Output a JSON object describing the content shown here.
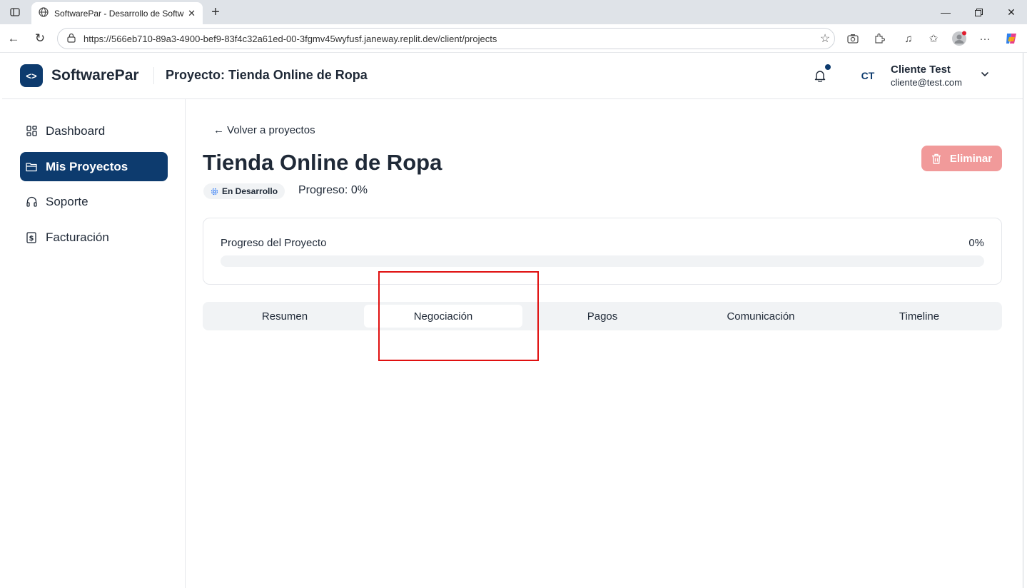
{
  "browser": {
    "tab_title": "SoftwarePar - Desarrollo de Softw",
    "url": "https://566eb710-89a3-4900-bef9-83f4c32a61ed-00-3fgmv45wyfusf.janeway.replit.dev/client/projects"
  },
  "header": {
    "logo_glyph": "<>",
    "brand": "SoftwarePar",
    "project_title": "Proyecto: Tienda Online de Ropa",
    "avatar_initials": "CT",
    "user_name": "Cliente Test",
    "user_email": "cliente@test.com"
  },
  "sidebar": {
    "items": [
      {
        "label": "Dashboard",
        "icon": "grid-icon"
      },
      {
        "label": "Mis Proyectos",
        "icon": "folder-icon",
        "active": true
      },
      {
        "label": "Soporte",
        "icon": "headset-icon"
      },
      {
        "label": "Facturación",
        "icon": "dollar-receipt-icon"
      }
    ]
  },
  "main": {
    "back_link": "← Volver a proyectos",
    "title": "Tienda Online de Ropa",
    "delete_label": "Eliminar",
    "status": "En Desarrollo",
    "progress_inline": "Progreso: 0%",
    "progress_card": {
      "label": "Progreso del Proyecto",
      "value_text": "0%",
      "value": 0
    },
    "tabs": [
      {
        "label": "Resumen"
      },
      {
        "label": "Negociación",
        "active": true
      },
      {
        "label": "Pagos"
      },
      {
        "label": "Comunicación"
      },
      {
        "label": "Timeline"
      }
    ]
  },
  "colors": {
    "primary": "#0d3b6e",
    "danger_soft": "#f19a9a",
    "highlight": "#e01010"
  }
}
